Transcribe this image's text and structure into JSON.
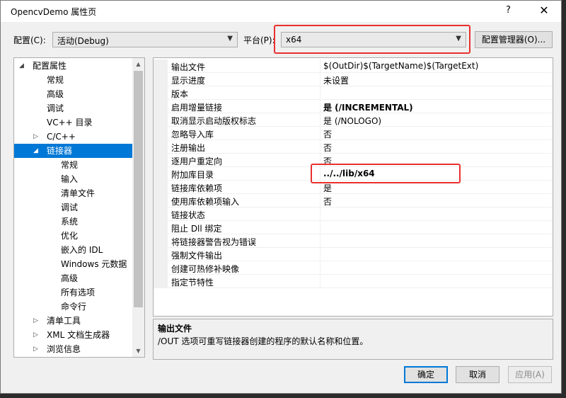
{
  "window": {
    "title": "OpencvDemo 属性页",
    "help_glyph": "?",
    "close_glyph": "✕"
  },
  "config_bar": {
    "config_label": "配置(C):",
    "config_value": "活动(Debug)",
    "platform_label": "平台(P):",
    "platform_value": "x64",
    "manager_button": "配置管理器(O)..."
  },
  "tree": {
    "items": [
      {
        "label": "配置属性",
        "expander": "◢"
      },
      {
        "label": "常规",
        "expander": ""
      },
      {
        "label": "高级",
        "expander": ""
      },
      {
        "label": "调试",
        "expander": ""
      },
      {
        "label": "VC++ 目录",
        "expander": ""
      },
      {
        "label": "C/C++",
        "expander": "▷"
      },
      {
        "label": "链接器",
        "expander": "◢",
        "selected": true
      },
      {
        "label": "常规",
        "expander": ""
      },
      {
        "label": "输入",
        "expander": ""
      },
      {
        "label": "清单文件",
        "expander": ""
      },
      {
        "label": "调试",
        "expander": ""
      },
      {
        "label": "系统",
        "expander": ""
      },
      {
        "label": "优化",
        "expander": ""
      },
      {
        "label": "嵌入的 IDL",
        "expander": ""
      },
      {
        "label": "Windows 元数据",
        "expander": ""
      },
      {
        "label": "高级",
        "expander": ""
      },
      {
        "label": "所有选项",
        "expander": ""
      },
      {
        "label": "命令行",
        "expander": ""
      },
      {
        "label": "清单工具",
        "expander": "▷"
      },
      {
        "label": "XML 文档生成器",
        "expander": "▷"
      },
      {
        "label": "浏览信息",
        "expander": "▷"
      }
    ]
  },
  "properties": {
    "rows": [
      {
        "name": "输出文件",
        "value": "$(OutDir)$(TargetName)$(TargetExt)",
        "bold": false
      },
      {
        "name": "显示进度",
        "value": "未设置",
        "bold": false
      },
      {
        "name": "版本",
        "value": "",
        "bold": false
      },
      {
        "name": "启用增量链接",
        "value": "是 (/INCREMENTAL)",
        "bold": true
      },
      {
        "name": "取消显示启动版权标志",
        "value": "是 (/NOLOGO)",
        "bold": false
      },
      {
        "name": "忽略导入库",
        "value": "否",
        "bold": false
      },
      {
        "name": "注册输出",
        "value": "否",
        "bold": false
      },
      {
        "name": "逐用户重定向",
        "value": "否",
        "bold": false
      },
      {
        "name": "附加库目录",
        "value": "../../lib/x64",
        "bold": true
      },
      {
        "name": "链接库依赖项",
        "value": "是",
        "bold": false
      },
      {
        "name": "使用库依赖项输入",
        "value": "否",
        "bold": false
      },
      {
        "name": "链接状态",
        "value": "",
        "bold": false
      },
      {
        "name": "阻止 Dll 绑定",
        "value": "",
        "bold": false
      },
      {
        "name": "将链接器警告视为错误",
        "value": "",
        "bold": false
      },
      {
        "name": "强制文件输出",
        "value": "",
        "bold": false
      },
      {
        "name": "创建可热修补映像",
        "value": "",
        "bold": false
      },
      {
        "name": "指定节特性",
        "value": "",
        "bold": false
      }
    ]
  },
  "description": {
    "title": "输出文件",
    "text": "/OUT 选项可重写链接器创建的程序的默认名称和位置。"
  },
  "buttons": {
    "ok": "确定",
    "cancel": "取消",
    "apply": "应用(A)"
  },
  "colors": {
    "selection": "#0078d7",
    "highlight_box": "#e8312f"
  }
}
